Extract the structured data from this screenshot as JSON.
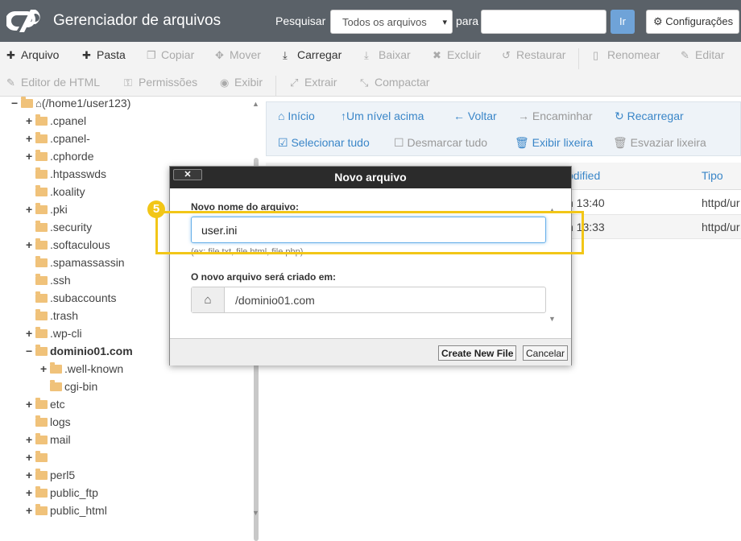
{
  "app": {
    "title": "Gerenciador de arquivos"
  },
  "search": {
    "label": "Pesquisar",
    "scope": "Todos os arquivos",
    "for_label": "para",
    "query": "",
    "go_label": "Ir"
  },
  "settings": {
    "label": "Configurações"
  },
  "toolbar": {
    "row1": [
      {
        "label": "Arquivo",
        "icon": "plus-icon",
        "enabled": true
      },
      {
        "label": "Pasta",
        "icon": "plus-icon",
        "enabled": true
      },
      {
        "label": "Copiar",
        "icon": "copy-icon",
        "enabled": false
      },
      {
        "label": "Mover",
        "icon": "move-icon",
        "enabled": false
      },
      {
        "label": "Carregar",
        "icon": "upload-icon",
        "enabled": true
      },
      {
        "label": "Baixar",
        "icon": "download-icon",
        "enabled": false
      },
      {
        "label": "Excluir",
        "icon": "times-icon",
        "enabled": false
      },
      {
        "label": "Restaurar",
        "icon": "undo-icon",
        "enabled": false
      },
      {
        "label": "Renomear",
        "icon": "file-icon",
        "enabled": false
      },
      {
        "label": "Editar",
        "icon": "pencil-icon",
        "enabled": false
      }
    ],
    "row2": [
      {
        "label": "Editor de HTML",
        "icon": "edit-icon",
        "enabled": false
      },
      {
        "label": "Permissões",
        "icon": "key-icon",
        "enabled": false
      },
      {
        "label": "Exibir",
        "icon": "eye-icon",
        "enabled": false
      },
      {
        "label": "Extrair",
        "icon": "expand-icon",
        "enabled": false
      },
      {
        "label": "Compactar",
        "icon": "compress-icon",
        "enabled": false
      }
    ]
  },
  "tree": {
    "root": "(/home1/user123)",
    "items": [
      {
        "label": ".cpanel",
        "expandable": true,
        "bold": false
      },
      {
        "label": ".cpanel-",
        "expandable": true,
        "bold": false
      },
      {
        "label": ".cphorde",
        "expandable": true,
        "bold": false
      },
      {
        "label": ".htpasswds",
        "expandable": false,
        "bold": false
      },
      {
        "label": ".koality",
        "expandable": false,
        "bold": false
      },
      {
        "label": ".pki",
        "expandable": true,
        "bold": false
      },
      {
        "label": ".security",
        "expandable": false,
        "bold": false
      },
      {
        "label": ".softaculous",
        "expandable": true,
        "bold": false
      },
      {
        "label": ".spamassassin",
        "expandable": false,
        "bold": false
      },
      {
        "label": ".ssh",
        "expandable": false,
        "bold": false
      },
      {
        "label": ".subaccounts",
        "expandable": false,
        "bold": false
      },
      {
        "label": ".trash",
        "expandable": false,
        "bold": false
      },
      {
        "label": ".wp-cli",
        "expandable": true,
        "bold": false
      },
      {
        "label": "dominio01.com",
        "expandable": true,
        "expanded": true,
        "bold": true
      },
      {
        "label": ".well-known",
        "expandable": true,
        "bold": false,
        "child": true
      },
      {
        "label": "cgi-bin",
        "expandable": false,
        "bold": false,
        "child": true
      },
      {
        "label": "etc",
        "expandable": true,
        "bold": false
      },
      {
        "label": "logs",
        "expandable": false,
        "bold": false
      },
      {
        "label": "mail",
        "expandable": true,
        "bold": false
      },
      {
        "label": "",
        "expandable": true,
        "bold": false
      },
      {
        "label": "perl5",
        "expandable": true,
        "bold": false
      },
      {
        "label": "public_ftp",
        "expandable": true,
        "bold": false
      },
      {
        "label": "public_html",
        "expandable": true,
        "bold": false
      }
    ]
  },
  "nav": {
    "row1": [
      "Início",
      "Um nível acima",
      "Voltar",
      "Encaminhar",
      "Recarregar"
    ],
    "row2": [
      "Selecionar tudo",
      "Desmarcar tudo",
      "Exibir lixeira",
      "Esvaziar lixeira"
    ]
  },
  "table": {
    "headers": [
      "odified",
      "Tipo"
    ],
    "rows": [
      {
        "modified": "n 13:40",
        "type": "httpd/ur"
      },
      {
        "modified": "n 13:33",
        "type": "httpd/ur"
      }
    ]
  },
  "modal": {
    "title": "Novo arquivo",
    "close_label": "✕",
    "name_label": "Novo nome do arquivo:",
    "name_value": "user.ini",
    "name_hint": "(ex: file.txt, file.html, file.php)",
    "location_label": "O novo arquivo será criado em:",
    "location_value": "/dominio01.com",
    "create_label": "Create New File",
    "cancel_label": "Cancelar"
  },
  "annotation": {
    "step": "5",
    "color": "#f2c617"
  }
}
